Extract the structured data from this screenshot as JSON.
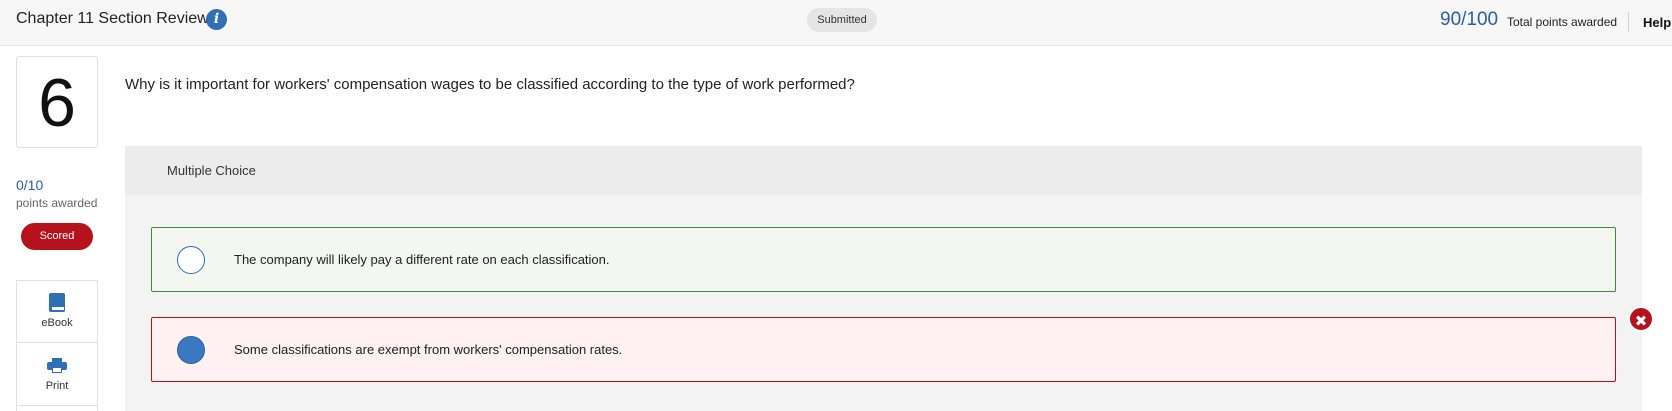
{
  "header": {
    "title": "Chapter 11 Section Review",
    "info_icon": "i",
    "status": "Submitted",
    "score": "90/100",
    "score_label": "Total points awarded",
    "help": "Help"
  },
  "sidebar": {
    "question_number": "6",
    "points": "0/10",
    "points_label": "points awarded",
    "badge": "Scored",
    "badge_color": "#b5121b",
    "tools": [
      {
        "label": "eBook",
        "icon": "book-icon"
      },
      {
        "label": "Print",
        "icon": "printer-icon"
      }
    ]
  },
  "question": {
    "text": "Why is it important for workers' compensation wages to be classified according to the type of work performed?",
    "type": "Multiple Choice",
    "options": [
      {
        "text": "The company will likely pay a different rate on each classification.",
        "selected": false,
        "state": "correct",
        "border_color": "#3c8a3c"
      },
      {
        "text": "Some classifications are exempt from workers' compensation rates.",
        "selected": true,
        "state": "incorrect",
        "border_color": "#b5121b",
        "status_icon": "✖"
      }
    ]
  }
}
